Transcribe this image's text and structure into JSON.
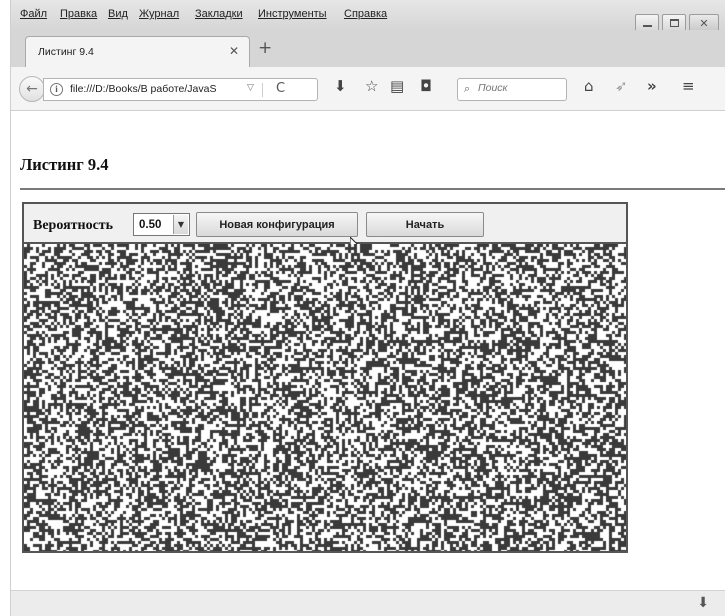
{
  "menu": [
    "Файл",
    "Правка",
    "Вид",
    "Журнал",
    "Закладки",
    "Инструменты",
    "Справка"
  ],
  "tab": {
    "title": "Листинг 9.4"
  },
  "url": {
    "text": "file:///D:/Books/В работе/JavaS"
  },
  "search": {
    "placeholder": "Поиск"
  },
  "page": {
    "title": "Листинг 9.4",
    "probability_label": "Вероятность",
    "probability_value": "0.50",
    "new_config_label": "Новая конфигурация",
    "start_label": "Начать"
  },
  "grid": {
    "fill_probability": 0.5,
    "cell_color": "#3a3a3a",
    "background": "#ffffff"
  },
  "colors": {
    "chrome": "#d6d6d6",
    "toolbar": "#f4f4f4"
  }
}
